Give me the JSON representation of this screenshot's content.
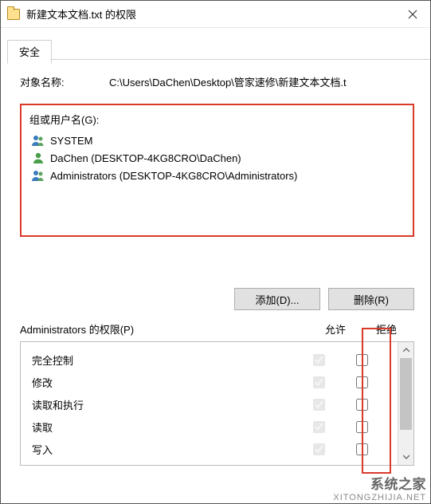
{
  "window": {
    "title": "新建文本文档.txt 的权限"
  },
  "tabs": {
    "security": "安全"
  },
  "object": {
    "label": "对象名称:",
    "path": "C:\\Users\\DaChen\\Desktop\\管家速修\\新建文本文档.t"
  },
  "groups": {
    "label": "组或用户名(G):",
    "items": [
      {
        "type": "group",
        "name": "SYSTEM"
      },
      {
        "type": "user",
        "name": "DaChen (DESKTOP-4KG8CRO\\DaChen)"
      },
      {
        "type": "group",
        "name": "Administrators (DESKTOP-4KG8CRO\\Administrators)"
      }
    ]
  },
  "buttons": {
    "add": "添加(D)...",
    "remove": "删除(R)"
  },
  "permHeader": {
    "label": "Administrators 的权限(P)",
    "allow": "允许",
    "deny": "拒绝"
  },
  "permissions": [
    {
      "name": "完全控制",
      "allow": true,
      "deny": false
    },
    {
      "name": "修改",
      "allow": true,
      "deny": false
    },
    {
      "name": "读取和执行",
      "allow": true,
      "deny": false
    },
    {
      "name": "读取",
      "allow": true,
      "deny": false
    },
    {
      "name": "写入",
      "allow": true,
      "deny": false
    }
  ],
  "watermark": {
    "line1": "系统之家",
    "line2": "XITONGZHIJIA.NET"
  }
}
